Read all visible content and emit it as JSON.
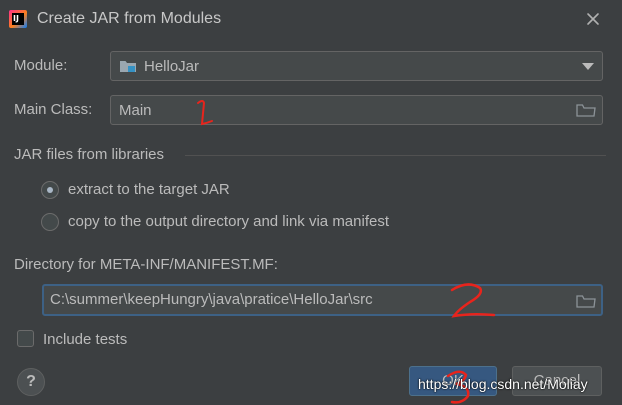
{
  "window": {
    "title": "Create JAR from Modules",
    "icon_name": "intellij-idea-icon",
    "icon_text": "IJ"
  },
  "module": {
    "label": "Module:",
    "value": "HelloJar"
  },
  "main_class": {
    "label": "Main Class:",
    "value": "Main"
  },
  "libraries": {
    "heading": "JAR files from libraries",
    "options": [
      {
        "label": "extract to the target JAR",
        "selected": true
      },
      {
        "label": "copy to the output directory and link via manifest",
        "selected": false
      }
    ]
  },
  "manifest": {
    "label": "Directory for META-INF/MANIFEST.MF:",
    "value": "C:\\summer\\keepHungry\\java\\pratice\\HelloJar\\src"
  },
  "include_tests": {
    "label": "Include tests",
    "checked": false
  },
  "buttons": {
    "ok_label": "OK",
    "cancel_label": "Cancel",
    "help_label": "?"
  },
  "overlay": {
    "watermark": "https://blog.csdn.net/Moliay",
    "annotation_1": "1",
    "annotation_2": "2",
    "annotation_3": "3",
    "annotation_color": "#e8241c"
  },
  "colors": {
    "background": "#3c3f41",
    "field_bg": "#45494a",
    "focus_border": "#3d6185",
    "default_button": "#365880",
    "module_icon_blue": "#3592c4"
  }
}
